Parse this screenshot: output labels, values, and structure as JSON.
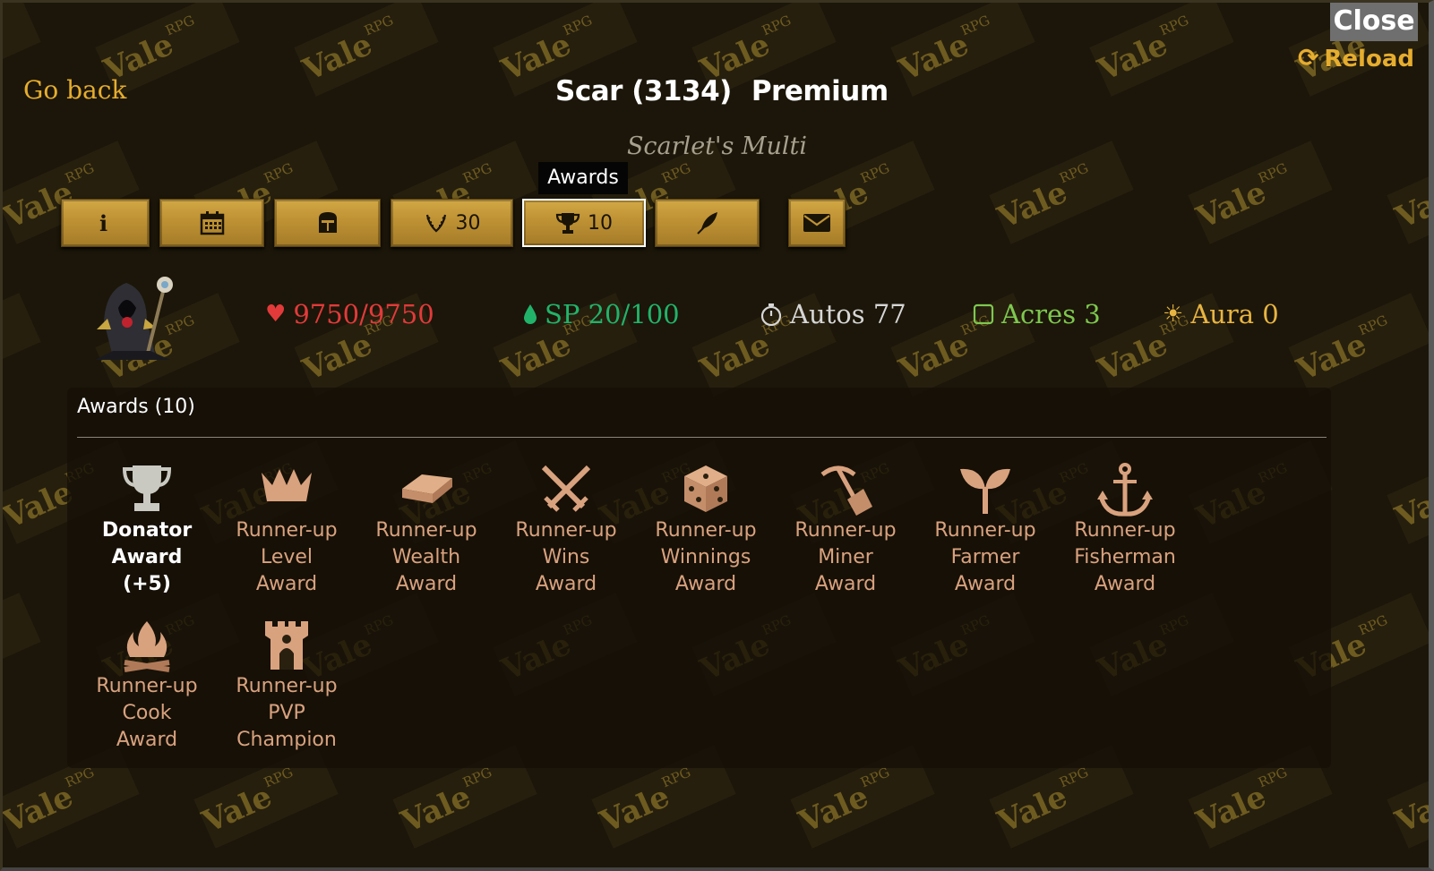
{
  "header": {
    "close_label": "Close",
    "reload_label": "Reload",
    "go_back_label": "Go back",
    "name": "Scar (3134)",
    "status": "Premium",
    "subtitle": "Scarlet's Multi",
    "tooltip": "Awards",
    "watermark": "Vale",
    "watermark_small": "RPG"
  },
  "tabs": [
    {
      "id": "info",
      "icon": "info-icon",
      "count": ""
    },
    {
      "id": "calendar",
      "icon": "calendar-icon",
      "count": ""
    },
    {
      "id": "equipment",
      "icon": "helmet-icon",
      "count": ""
    },
    {
      "id": "achievements",
      "icon": "laurel-icon",
      "count": "30"
    },
    {
      "id": "awards",
      "icon": "trophy-icon",
      "count": "10",
      "active": true
    },
    {
      "id": "notes",
      "icon": "quill-icon",
      "count": ""
    },
    {
      "id": "message",
      "icon": "envelope-icon",
      "count": ""
    }
  ],
  "stats": {
    "hp": "9750/9750",
    "sp": "SP 20/100",
    "autos": "Autos 77",
    "acres": "Acres 3",
    "aura": "Aura 0"
  },
  "colors": {
    "hp": "#e23a3a",
    "sp": "#22b36a",
    "autos": "#d6d6d6",
    "acres": "#7ec84f",
    "aura": "#e8b441",
    "gold": "#e6ad2e",
    "award_text": "#d9a27e"
  },
  "awards_panel": {
    "title": "Awards (10)",
    "items": [
      {
        "l1": "Donator",
        "l2": "Award",
        "l3": "(+5)",
        "icon": "trophy-icon"
      },
      {
        "l1": "Runner-up",
        "l2": "Level",
        "l3": "Award",
        "icon": "crown-icon"
      },
      {
        "l1": "Runner-up",
        "l2": "Wealth",
        "l3": "Award",
        "icon": "gold-bar-icon"
      },
      {
        "l1": "Runner-up",
        "l2": "Wins",
        "l3": "Award",
        "icon": "crossed-swords-icon"
      },
      {
        "l1": "Runner-up",
        "l2": "Winnings",
        "l3": "Award",
        "icon": "dice-icon"
      },
      {
        "l1": "Runner-up",
        "l2": "Miner",
        "l3": "Award",
        "icon": "pickaxe-icon"
      },
      {
        "l1": "Runner-up",
        "l2": "Farmer",
        "l3": "Award",
        "icon": "sprout-icon"
      },
      {
        "l1": "Runner-up",
        "l2": "Fisherman",
        "l3": "Award",
        "icon": "anchor-icon"
      },
      {
        "l1": "Runner-up",
        "l2": "Cook",
        "l3": "Award",
        "icon": "campfire-icon"
      },
      {
        "l1": "Runner-up",
        "l2": "PVP",
        "l3": "Champion",
        "icon": "castle-icon"
      }
    ]
  }
}
